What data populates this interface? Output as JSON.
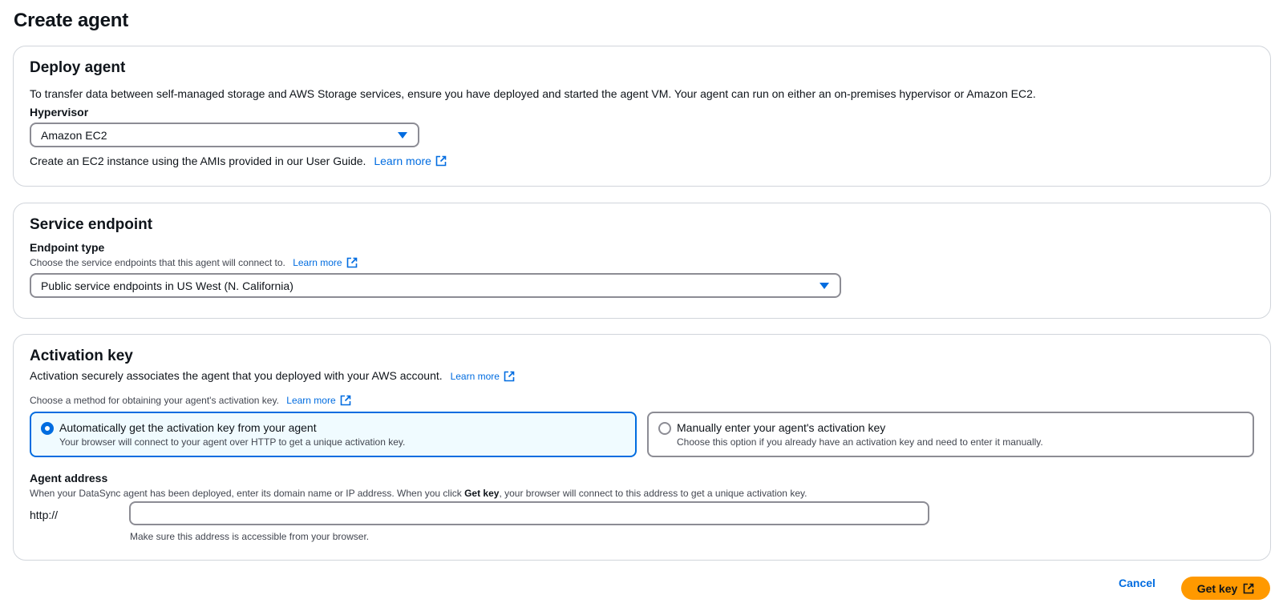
{
  "page": {
    "title": "Create agent"
  },
  "deploy": {
    "heading": "Deploy agent",
    "description": "To transfer data between self-managed storage and AWS Storage services, ensure you have deployed and started the agent VM. Your agent can run on either an on-premises hypervisor or Amazon EC2.",
    "hypervisor_label": "Hypervisor",
    "hypervisor_value": "Amazon EC2",
    "info_text": "Create an EC2 instance using the AMIs provided in our User Guide.",
    "learn_more": "Learn more"
  },
  "endpoint": {
    "heading": "Service endpoint",
    "type_label": "Endpoint type",
    "type_description": "Choose the service endpoints that this agent will connect to.",
    "learn_more": "Learn more",
    "type_value": "Public service endpoints in US West (N. California)"
  },
  "activation": {
    "heading": "Activation key",
    "description": "Activation securely associates the agent that you deployed with your AWS account.",
    "learn_more": "Learn more",
    "method_description": "Choose a method for obtaining your agent's activation key.",
    "method_learn_more": "Learn more",
    "options": [
      {
        "title": "Automatically get the activation key from your agent",
        "description": "Your browser will connect to your agent over HTTP to get a unique activation key.",
        "selected": true
      },
      {
        "title": "Manually enter your agent's activation key",
        "description": "Choose this option if you already have an activation key and need to enter it manually.",
        "selected": false
      }
    ],
    "address_label": "Agent address",
    "address_desc_before": "When your DataSync agent has been deployed, enter its domain name or IP address. When you click ",
    "address_desc_bold": "Get key",
    "address_desc_after": ", your browser will connect to this address to get a unique activation key.",
    "protocol_prefix": "http://",
    "address_value": "",
    "address_hint": "Make sure this address is accessible from your browser."
  },
  "actions": {
    "cancel": "Cancel",
    "get_key": "Get key"
  },
  "colors": {
    "accent": "#006ce0",
    "primary_button": "#ff9900",
    "selected_tile_bg": "#f0fbff"
  },
  "icons": {
    "external_link": "external-link-icon",
    "dropdown_caret": "caret-down-icon",
    "radio": "radio-icon"
  }
}
